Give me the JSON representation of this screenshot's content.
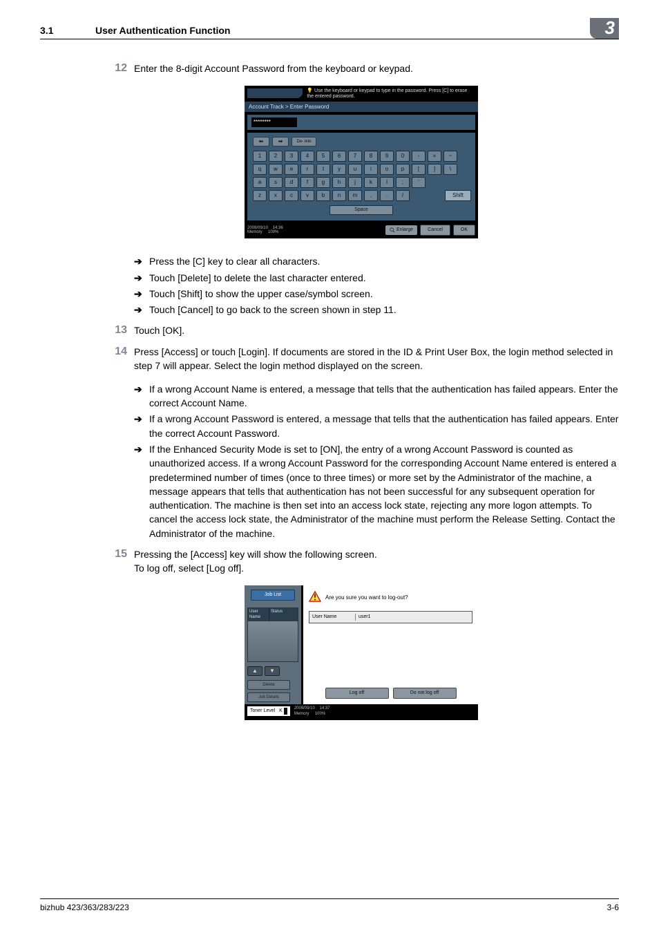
{
  "header": {
    "section_number": "3.1",
    "section_title": "User Authentication Function",
    "chapter_badge": "3"
  },
  "steps": {
    "s12": {
      "num": "12",
      "text": "Enter the 8-digit Account Password from the keyboard or keypad."
    },
    "s12_bullets": [
      "Press the [C] key to clear all characters.",
      "Touch [Delete] to delete the last character entered.",
      "Touch [Shift] to show the upper case/symbol screen.",
      "Touch [Cancel] to go back to the screen shown in step 11."
    ],
    "s13": {
      "num": "13",
      "text": "Touch [OK]."
    },
    "s14": {
      "num": "14",
      "text": "Press [Access] or touch [Login]. If documents are stored in the ID & Print User Box, the login method selected in step 7 will appear. Select the login method displayed on the screen."
    },
    "s14_bullets": [
      "If a wrong Account Name is entered, a message that tells that the authentication has failed appears. Enter the correct Account Name.",
      "If a wrong Account Password is entered, a message that tells that the authentication has failed appears. Enter the correct Account Password.",
      "If the Enhanced Security Mode is set to [ON], the entry of a wrong Account Password is counted as unauthorized access. If a wrong Account Password for the corresponding Account Name entered is entered a predetermined number of times (once to three times) or more set by the Administrator of the machine, a message appears that tells that authentication has not been successful for any subsequent operation for authentication. The machine is then set into an access lock state, rejecting any more logon attempts. To cancel the access lock state, the Administrator of the machine must perform the Release Setting. Contact the Administrator of the machine."
    ],
    "s15": {
      "num": "15",
      "line1": "Pressing the [Access] key will show the following screen.",
      "line2": "To log off, select [Log off]."
    }
  },
  "fig1": {
    "hint": "Use the keyboard or keypad to type in the password. Press [C] to erase the entered password.",
    "breadcrumb": "Account Track > Enter Password",
    "password_mask": "********",
    "delete_btn": "De-\nlete",
    "rows": {
      "r1": [
        "1",
        "2",
        "3",
        "4",
        "5",
        "6",
        "7",
        "8",
        "9",
        "0",
        "-",
        "=",
        "~"
      ],
      "r2": [
        "q",
        "w",
        "e",
        "r",
        "t",
        "y",
        "u",
        "i",
        "o",
        "p",
        "[",
        "]",
        "\\"
      ],
      "r3": [
        "a",
        "s",
        "d",
        "f",
        "g",
        "h",
        "j",
        "k",
        "l",
        ";",
        "'"
      ],
      "r4": [
        "z",
        "x",
        "c",
        "v",
        "b",
        "n",
        "m",
        ",",
        ".",
        "/"
      ]
    },
    "shift": "Shift",
    "space": "Space",
    "date": "2009/09/10",
    "time": "14:36",
    "mem_label": "Memory",
    "mem_pct": "100%",
    "enlarge": "Enlarge",
    "cancel": "Cancel",
    "ok": "OK"
  },
  "fig2": {
    "job_list": "Job List",
    "col_user": "User\nName",
    "col_status": "Status",
    "delete": "Delete",
    "job_details": "Job Details",
    "question": "Are you sure you want to log-out?",
    "un_label": "User Name",
    "un_value": "user1",
    "log_off": "Log off",
    "do_not": "Do not log off",
    "toner": "Toner Level",
    "toner_k": "K",
    "date": "2009/09/10",
    "time": "14:37",
    "mem_label": "Memory",
    "mem_pct": "100%"
  },
  "footer": {
    "left": "bizhub 423/363/283/223",
    "right": "3-6"
  }
}
